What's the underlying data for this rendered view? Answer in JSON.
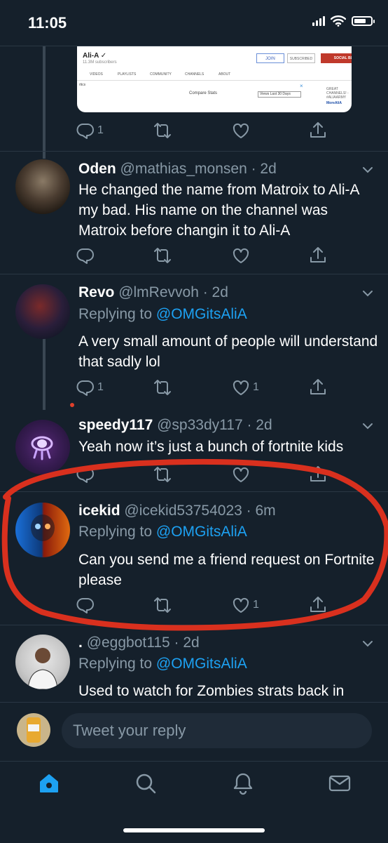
{
  "status_bar": {
    "time": "11:05"
  },
  "embed": {
    "channel_name": "Ali-A ✓",
    "subscribers": "11.3M subscribers",
    "join": "JOIN",
    "subscribed": "SUBSCRIBED",
    "social_blade": "SOCIAL BLADE STATS",
    "nav": [
      "VIDEOS",
      "PLAYLISTS",
      "COMMUNITY",
      "CHANNELS",
      "ABOUT"
    ],
    "compare": "Compare Stats",
    "views_select": "Views Last 30 Days",
    "great_channels": "GREAT CHANNELS! - #ALIAARMY",
    "more_ali": "MoreAliA",
    "left_label": "rtics",
    "close": "×"
  },
  "tweets": [
    {
      "id": "embed-actions",
      "reply_count": "1",
      "retweet_count": "",
      "like_count": ""
    },
    {
      "id": "oden",
      "name": "Oden",
      "handle": "@mathias_monsen · 2d",
      "replying_to": "",
      "text": "He changed the name from Matroix to Ali-A my bad. His name on the channel was Matroix before changin it to Ali-A",
      "reply_count": "",
      "like_count": ""
    },
    {
      "id": "revo",
      "name": "Revo",
      "handle": "@lmRevvoh · 2d",
      "replying_prefix": "Replying to ",
      "replying_to": "@OMGitsAliA",
      "text": "A very small amount of people will understand that sadly lol",
      "reply_count": "1",
      "like_count": "1"
    },
    {
      "id": "speedy",
      "name": "speedy117",
      "handle": "@sp33dy117 · 2d",
      "text": "Yeah now it’s just a bunch of fortnite kids",
      "reply_count": "",
      "like_count": ""
    },
    {
      "id": "icekid",
      "name": "icekid",
      "handle": "@icekid53754023 · 6m",
      "replying_prefix": "Replying to ",
      "replying_to": "@OMGitsAliA",
      "text": "Can you send me a friend request on Fortnite please",
      "reply_count": "",
      "like_count": "1"
    },
    {
      "id": "eggbot",
      "name": ".",
      "handle": "@eggbot115 · 2d",
      "replying_prefix": "Replying to ",
      "replying_to": "@OMGitsAliA",
      "text": "Used to watch for Zombies strats back in"
    }
  ],
  "compose": {
    "placeholder": "Tweet your reply"
  },
  "tabs": [
    "home-icon",
    "search-icon",
    "notifications-icon",
    "messages-icon"
  ],
  "colors": {
    "background": "#15202b",
    "accent": "#1da1f2",
    "muted": "#8899a6",
    "annotation": "#d9301e"
  }
}
